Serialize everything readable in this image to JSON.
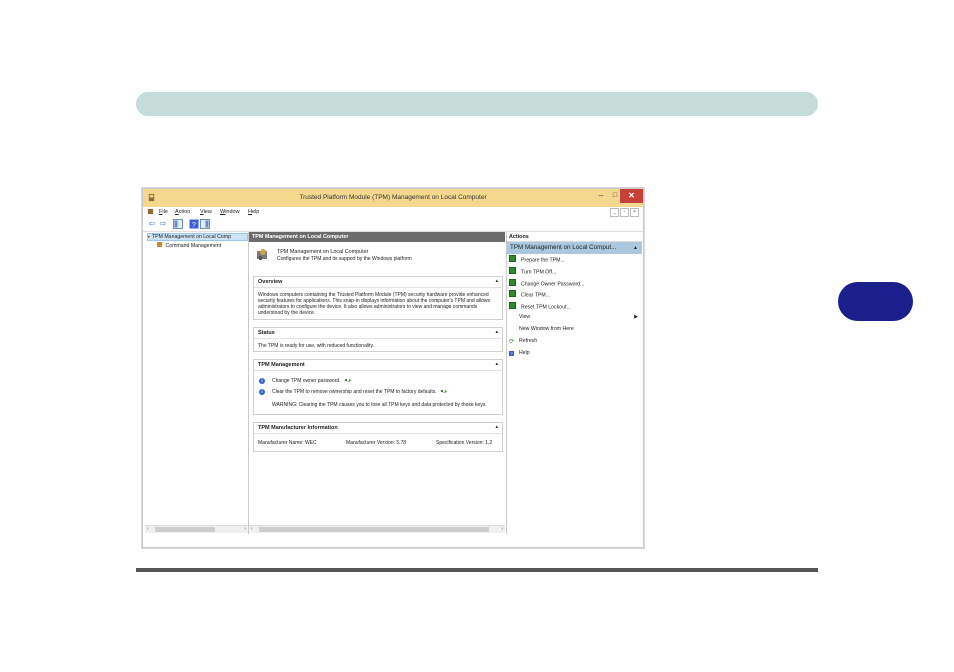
{
  "window": {
    "title": "Trusted Platform Module (TPM) Management on Local Computer",
    "minimize_glyph": "–",
    "maximize_glyph": "□",
    "close_glyph": "✕"
  },
  "menu": [
    "File",
    "Action",
    "View",
    "Window",
    "Help"
  ],
  "tree": {
    "root": "TPM Management on Local Comp",
    "child": "Command Management"
  },
  "center": {
    "header": "TPM Management on Local Computer",
    "intro_title": "TPM Management on Local Computer",
    "intro_sub": "Configures the TPM and its support by the Windows platform",
    "overview": {
      "title": "Overview",
      "text": "Windows computers containing the Trusted Platform Module (TPM) security hardware provide enhanced security features for applications. This snap-in displays information about the computer's TPM and allows administrators to configure the device. It also allows administrators to view and manage commands understood by the device."
    },
    "status": {
      "title": "Status",
      "text": "The TPM is ready for use, with reduced functionality."
    },
    "management": {
      "title": "TPM Management",
      "item1": "Change TPM owner password.",
      "item2": "Clear the TPM to remove ownership and reset the TPM to factory defaults.",
      "warning": "WARNING: Clearing the TPM causes you to lose all TPM keys and data protected by those keys."
    },
    "manufacturer": {
      "title": "TPM Manufacturer Information",
      "name_label": "Manufacturer Name:",
      "name_value": "WEC",
      "version_label": "Manufacturer Version:",
      "version_value": "5.78",
      "spec_label": "Specification Version:",
      "spec_value": "1.2"
    }
  },
  "actions": {
    "header": "Actions",
    "subheader": "TPM Management on Local Comput...",
    "items": [
      {
        "label": "Prepare the TPM..."
      },
      {
        "label": "Turn TPM Off..."
      },
      {
        "label": "Change Owner Password..."
      },
      {
        "label": "Clear TPM..."
      },
      {
        "label": "Reset TPM Lockout..."
      },
      {
        "label": "View"
      },
      {
        "label": "New Window from Here"
      },
      {
        "label": "Refresh"
      },
      {
        "label": "Help"
      }
    ]
  },
  "colors": {
    "header_bar": "#c6dcd8",
    "side_tab": "#1b1f8c",
    "titlebar": "#f4d88e",
    "actions_highlight": "#a9c7df",
    "close_button": "#c7413b"
  }
}
